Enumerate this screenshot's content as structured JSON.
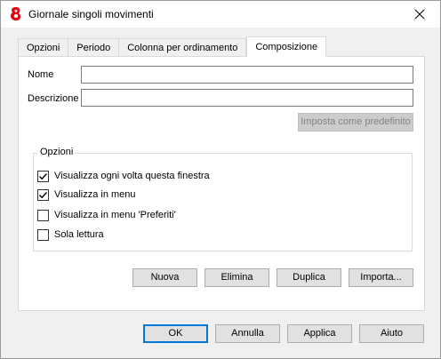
{
  "window": {
    "title": "Giornale singoli movimenti",
    "close_icon": "close-icon",
    "app_icon": "banana-app-icon"
  },
  "tabs": [
    {
      "label": "Opzioni",
      "active": false
    },
    {
      "label": "Periodo",
      "active": false
    },
    {
      "label": "Colonna per ordinamento",
      "active": false
    },
    {
      "label": "Composizione",
      "active": true
    }
  ],
  "form": {
    "nome_label": "Nome",
    "nome_value": "",
    "descrizione_label": "Descrizione",
    "descrizione_value": "",
    "imposta_button": "Imposta come predefinito"
  },
  "options_group": {
    "title": "Opzioni",
    "items": [
      {
        "label": "Visualizza ogni volta questa finestra",
        "checked": true
      },
      {
        "label": "Visualizza in menu",
        "checked": true
      },
      {
        "label": "Visualizza in menu 'Preferiti'",
        "checked": false
      },
      {
        "label": "Sola lettura",
        "checked": false
      }
    ]
  },
  "action_buttons": {
    "nuova": "Nuova",
    "elimina": "Elimina",
    "duplica": "Duplica",
    "importa": "Importa..."
  },
  "footer_buttons": {
    "ok": "OK",
    "annulla": "Annulla",
    "applica": "Applica",
    "aiuto": "Aiuto"
  }
}
